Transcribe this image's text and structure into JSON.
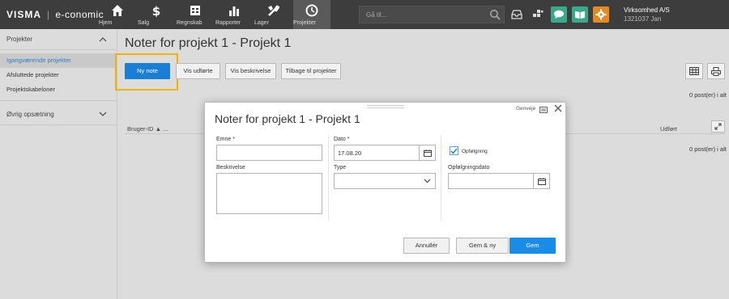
{
  "topbar": {
    "logo_brand": "VISMA",
    "logo_separator": "|",
    "logo_product": "e-conomic",
    "nav": [
      {
        "label": "Hjem",
        "icon": "home-icon"
      },
      {
        "label": "Salg",
        "icon": "dollar-icon"
      },
      {
        "label": "Regnskab",
        "icon": "ledger-icon"
      },
      {
        "label": "Rapporter",
        "icon": "bar-chart-icon"
      },
      {
        "label": "Lager",
        "icon": "wrench-icon"
      },
      {
        "label": "Projekter",
        "icon": "clock-icon"
      }
    ],
    "search_placeholder": "Gå til...",
    "company_name": "Virksomhed A/S",
    "company_number": "1321037  Jan",
    "colors": {
      "bar": "#3d3d3d",
      "chat": "#3aa88b",
      "book": "#3aa88b",
      "settings": "#e38a24"
    }
  },
  "sidebar": {
    "section_title": "Projekter",
    "items": [
      {
        "label": "Igangværende projekter",
        "active": true
      },
      {
        "label": "Afsluttede projekter",
        "active": false
      },
      {
        "label": "Projektskabeloner",
        "active": false
      }
    ],
    "section2_title": "Øvrig opsætning"
  },
  "main": {
    "title": "Noter for projekt 1 - Projekt 1",
    "buttons": {
      "new_note": "Ny note",
      "show_done": "Vis udførte",
      "show_description": "Vis beskrivelse",
      "back": "Tilbage til projekter"
    },
    "count_top": "0 post(er) i alt",
    "count_bottom": "0 post(er) i alt",
    "columns": {
      "user_id": "Bruger-ID ▲ ...",
      "done": "Udført"
    },
    "accent": "#1a7ed4",
    "highlight": "#f0b400"
  },
  "modal": {
    "title": "Noter for projekt 1 - Projekt 1",
    "shortcuts": "Genveje",
    "subject_label": "Emne *",
    "subject_value": "",
    "description_label": "Beskrivelse",
    "date_label": "Dato *",
    "date_value": "17.08.20",
    "type_label": "Type",
    "type_value": "",
    "followup_label": "Opfølgning",
    "followup_checked": true,
    "followup_date_label": "Opfølgningsdato",
    "followup_date_value": "",
    "buttons": {
      "cancel": "Annullér",
      "save_new": "Gem & ny",
      "save": "Gem"
    }
  }
}
